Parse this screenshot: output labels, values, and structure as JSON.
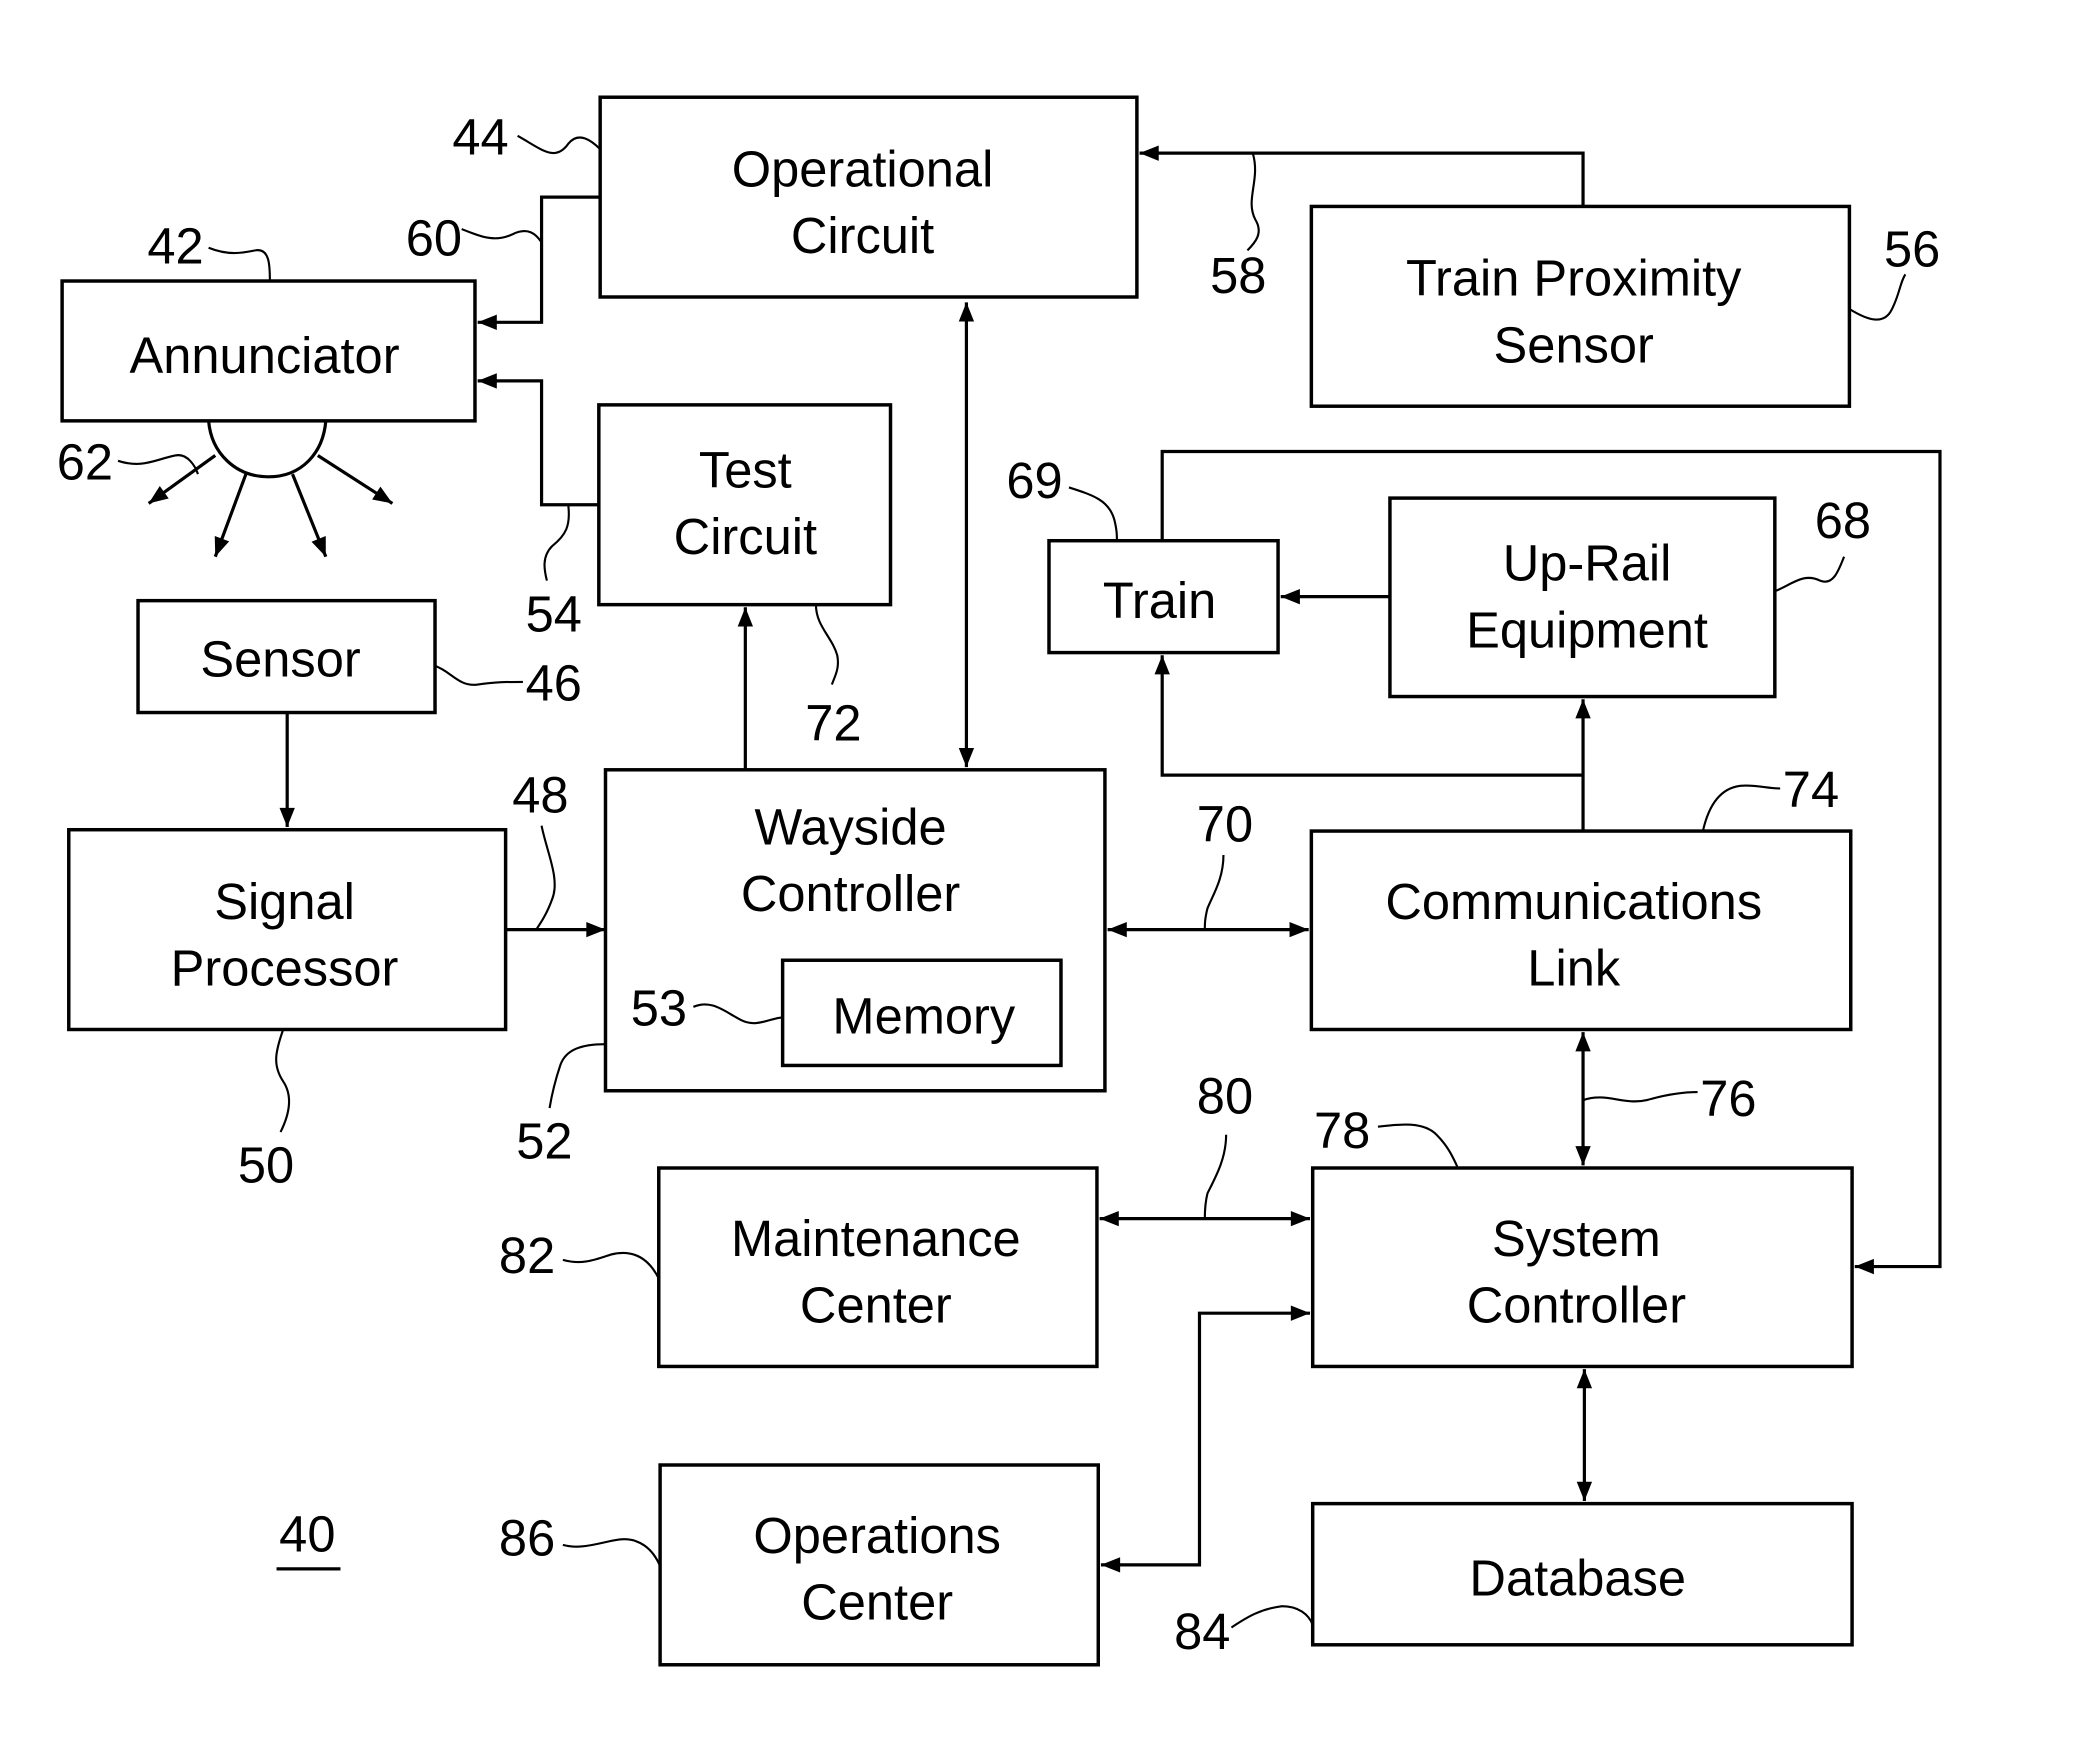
{
  "figure": {
    "reference": "40",
    "blocks": {
      "operational_circuit": {
        "lines": [
          "Operational",
          "Circuit"
        ],
        "ref": "44"
      },
      "annunciator": {
        "lines": [
          "Annunciator"
        ],
        "ref": "42"
      },
      "train_proximity_sensor": {
        "lines": [
          "Train Proximity",
          "Sensor"
        ],
        "ref": "56"
      },
      "test_circuit": {
        "lines": [
          "Test",
          "Circuit"
        ],
        "ref": "54"
      },
      "sensor": {
        "lines": [
          "Sensor"
        ],
        "ref": "46"
      },
      "signal_processor": {
        "lines": [
          "Signal",
          "Processor"
        ],
        "ref": "50"
      },
      "wayside_controller": {
        "lines": [
          "Wayside",
          "Controller"
        ],
        "ref": "52"
      },
      "memory": {
        "lines": [
          "Memory"
        ],
        "ref": "53"
      },
      "train": {
        "lines": [
          "Train"
        ],
        "ref": "69"
      },
      "up_rail_equipment": {
        "lines": [
          "Up-Rail",
          "Equipment"
        ],
        "ref": "68"
      },
      "communications_link": {
        "lines": [
          "Communications",
          "Link"
        ],
        "ref": "74"
      },
      "system_controller": {
        "lines": [
          "System",
          "Controller"
        ],
        "ref": "78"
      },
      "maintenance_center": {
        "lines": [
          "Maintenance",
          "Center"
        ],
        "ref": "82"
      },
      "operations_center": {
        "lines": [
          "Operations",
          "Center"
        ],
        "ref": "86"
      },
      "database": {
        "lines": [
          "Database"
        ],
        "ref": "84"
      }
    },
    "connection_refs": {
      "sensor_to_processor": "48",
      "op_to_annunciator": "60",
      "tps_to_op": "58",
      "annunciator_light": "62",
      "test_to_wayside": "72",
      "wayside_to_comm": "70",
      "comm_to_system": "76",
      "maint_to_system": "80"
    }
  }
}
